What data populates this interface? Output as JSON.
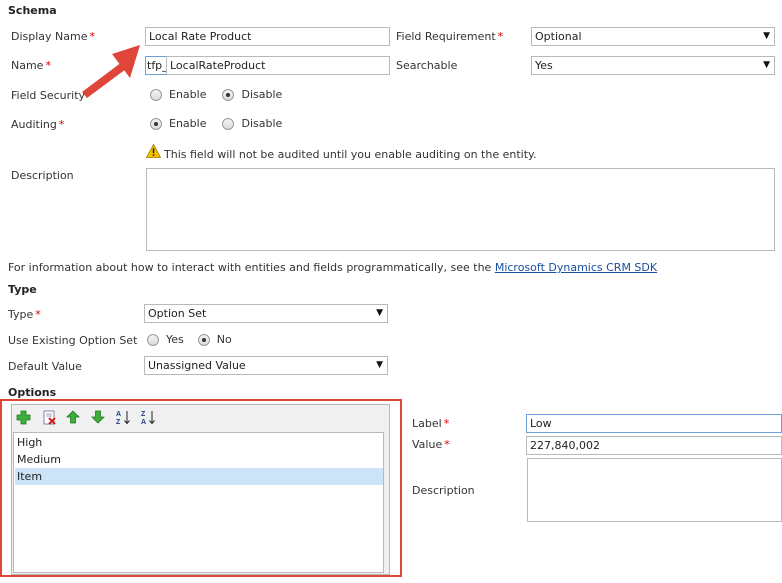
{
  "schema": {
    "heading": "Schema",
    "display_name": {
      "label": "Display Name",
      "required": "*",
      "value": "Local Rate Product"
    },
    "name": {
      "label": "Name",
      "required": "*",
      "prefix": "tfp_",
      "value": "LocalRateProduct"
    },
    "field_requirement": {
      "label": "Field Requirement",
      "required": "*",
      "value": "Optional"
    },
    "searchable": {
      "label": "Searchable",
      "value": "Yes"
    },
    "field_security": {
      "label": "Field Security",
      "option_enable": "Enable",
      "option_disable": "Disable",
      "selected": "Disable"
    },
    "auditing": {
      "label": "Auditing",
      "required": "*",
      "option_enable": "Enable",
      "option_disable": "Disable",
      "selected": "Enable"
    },
    "audit_warning": "This field will not be audited until you enable auditing on the entity.",
    "description": {
      "label": "Description",
      "value": ""
    }
  },
  "info": {
    "text": "For information about how to interact with entities and fields programmatically, see the ",
    "link": "Microsoft Dynamics CRM SDK"
  },
  "type": {
    "heading": "Type",
    "type_field": {
      "label": "Type",
      "required": "*",
      "value": "Option Set"
    },
    "use_existing": {
      "label": "Use Existing Option Set",
      "option_yes": "Yes",
      "option_no": "No",
      "selected": "No"
    },
    "default_value": {
      "label": "Default Value",
      "value": "Unassigned Value"
    }
  },
  "options": {
    "heading": "Options",
    "items": [
      "High",
      "Medium",
      "Item"
    ],
    "selected_index": 2,
    "label": {
      "label": "Label",
      "required": "*",
      "value": "Low"
    },
    "value": {
      "label": "Value",
      "required": "*",
      "value": "227,840,002"
    },
    "description": {
      "label": "Description",
      "value": ""
    }
  },
  "colors": {
    "annotation_red": "#e0453a",
    "link_blue": "#1a4fa0",
    "selected_row": "#cde3f7",
    "active_border": "#6ea0d8"
  }
}
